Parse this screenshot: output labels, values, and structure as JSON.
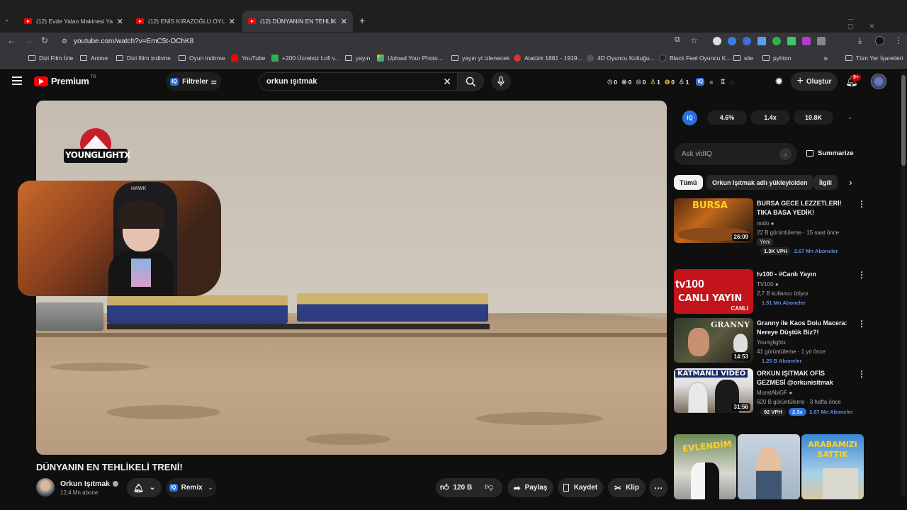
{
  "browser": {
    "tabs": [
      {
        "title": "(12) Evde Yalan Makinesi Yaptım"
      },
      {
        "title": "(12) ENİS KIRAZOĞLU OYUN OYNUYOR"
      },
      {
        "title": "(12) DÜNYANIN EN TEHLİKELİ TRENİ"
      }
    ],
    "new_tab": "+",
    "url": "youtube.com/watch?v=EmC5t-OChK8",
    "bookmarks": [
      "Dizi Film İzle",
      "Anime",
      "Dizi filim indirme",
      "Oyun indirme",
      "YouTube",
      "+200 Ücretsiz Lofi v...",
      "yayın",
      "Upload Your Photo...",
      "yayın yt izlenecek",
      "Atatürk 1881 - 1919...",
      "4D Oyuncu Koltuğu...",
      "Black Feel Oyuncu K...",
      "site",
      "pyhton"
    ],
    "bookmarks_more": "»",
    "all_bookmarks": "Tüm Yer İşaretleri"
  },
  "header": {
    "logo_text": "Premium",
    "logo_sup": "TR",
    "filters_label": "Filtreler",
    "search_value": "orkun ışıtmak",
    "stats": [
      "0",
      "0",
      "0",
      "1",
      "0",
      "1"
    ],
    "create_label": "Oluştur",
    "notif_badge": "9+"
  },
  "player": {
    "channel_logo_text": "YOUNGLIGHTX",
    "webcam_text": "HAWK"
  },
  "video": {
    "title": "DÜNYANIN EN TEHLİKELİ TRENİ!",
    "channel": "Orkun Işıtmak",
    "subscribers": "12,4 Mn abone",
    "remix_label": "Remix",
    "likes": "120 B",
    "share_label": "Paylaş",
    "save_label": "Kaydet",
    "clip_label": "Klip"
  },
  "vidiq": {
    "stats": [
      "4.6%",
      "1.4x",
      "10.8K"
    ],
    "ask_placeholder": "Ask vidIQ",
    "summarize_label": "Summarize"
  },
  "chips": [
    "Tümü",
    "Orkun Işıtmak adlı yükleyiciden",
    "İlgili"
  ],
  "recommendations": [
    {
      "title": "BURSA GECE LEZZETLERİ! TIKA BASA YEDİK!",
      "channel": "mido",
      "meta": "22 B görüntüleme · 15 saat önce",
      "badge": "Yeni",
      "vph": "1.3K VPH",
      "subs": "2.67 Mn Aboneler",
      "duration": "26:09",
      "thumb_text": "BURSA"
    },
    {
      "title": "tv100 - #Canlı Yayın",
      "channel": "TV100",
      "meta": "2,7 B kullanıcı izliyor",
      "subs": "1.51 Mn Aboneler",
      "thumb_text": "CANLI YAYIN",
      "thumb_brand": "tv100",
      "live": "CANLI"
    },
    {
      "title": "Granny ile Kaos Dolu Macera: Nereye Düştük Biz?!",
      "channel": "Younglightx",
      "meta": "41 görüntüleme · 1 yıl önce",
      "subs": "1.25 B Aboneler",
      "duration": "14:53",
      "thumb_text": "GRANNY"
    },
    {
      "title": "ORKUN IŞITMAK OFİS GEZMESİ @orkunisitmak",
      "channel": "MuratAbiGF",
      "meta": "620 B görüntüleme · 3 hafta önce",
      "vph": "92 VPH",
      "ratio": "2.3x",
      "subs": "2.87 Mn Aboneler",
      "duration": "31:56",
      "thumb_text": "KATMANLI VİDEO"
    }
  ],
  "shorts": [
    "EVLENDİM",
    "",
    "ARABAMIZI SATTIK"
  ]
}
